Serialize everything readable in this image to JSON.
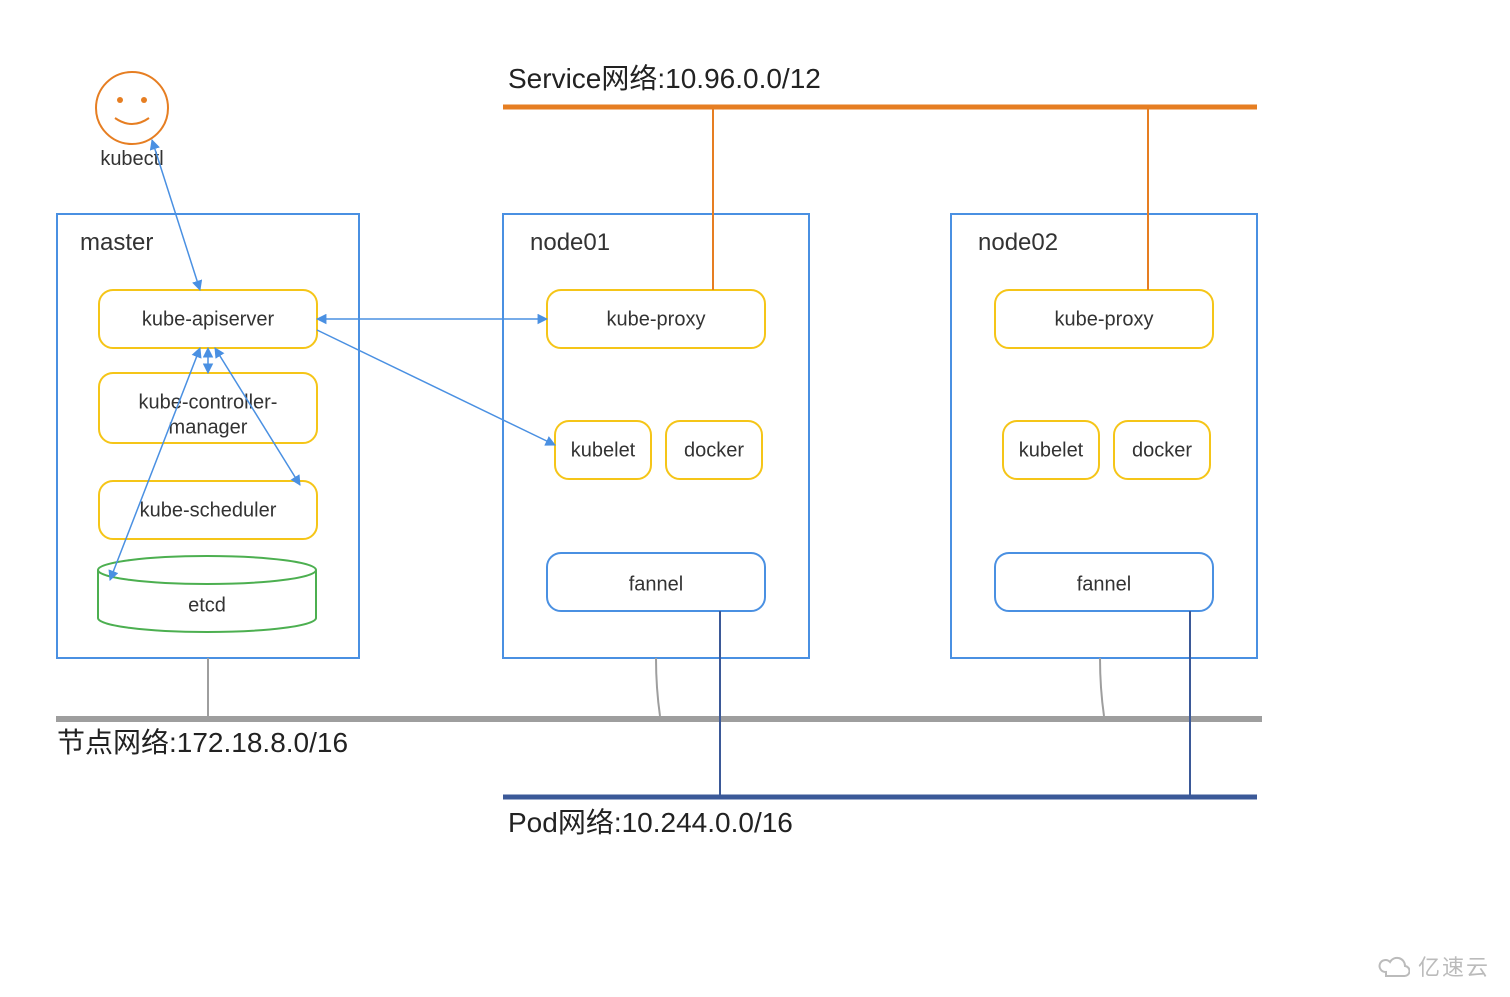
{
  "kubectl": {
    "label": "kubectl"
  },
  "networks": {
    "service": "Service网络:10.96.0.0/12",
    "node": "节点网络:172.18.8.0/16",
    "pod": "Pod网络:10.244.0.0/16"
  },
  "master": {
    "title": "master",
    "apiserver": "kube-apiserver",
    "controller": "kube-controller-manager",
    "scheduler": "kube-scheduler",
    "etcd": "etcd"
  },
  "node01": {
    "title": "node01",
    "proxy": "kube-proxy",
    "kubelet": "kubelet",
    "docker": "docker",
    "flannel": "fannel"
  },
  "node02": {
    "title": "node02",
    "proxy": "kube-proxy",
    "kubelet": "kubelet",
    "docker": "docker",
    "flannel": "fannel"
  },
  "watermark": "亿速云"
}
